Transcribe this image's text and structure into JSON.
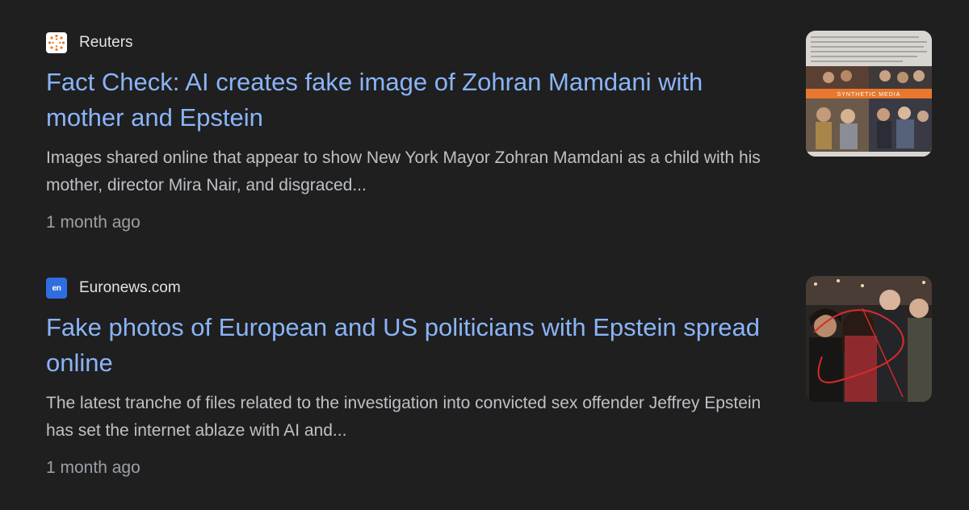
{
  "results": [
    {
      "source": "Reuters",
      "favicon": "reuters-logo-icon",
      "title": "Fact Check: AI creates fake image of Zohran Mamdani with mother and Epstein",
      "snippet": "Images shared online that appear to show New York Mayor Zohran Mamdani as a child with his mother, director Mira Nair, and disgraced...",
      "time": "1 month ago",
      "thumbnail_banner": "SYNTHETIC MEDIA"
    },
    {
      "source": "Euronews.com",
      "favicon": "euronews-logo-icon",
      "favicon_text": "en",
      "title": "Fake photos of European and US politicians with Epstein spread online",
      "snippet": "The latest tranche of files related to the investigation into convicted sex offender Jeffrey Epstein has set the internet ablaze with AI and...",
      "time": "1 month ago"
    }
  ],
  "colors": {
    "background": "#1f1f1f",
    "link": "#8ab4f8",
    "snippet": "#bdc1c6",
    "meta": "#9aa0a6",
    "source": "#e3e3e3",
    "reuters_orange": "#e8782d",
    "euronews_blue": "#2f6ee0"
  }
}
